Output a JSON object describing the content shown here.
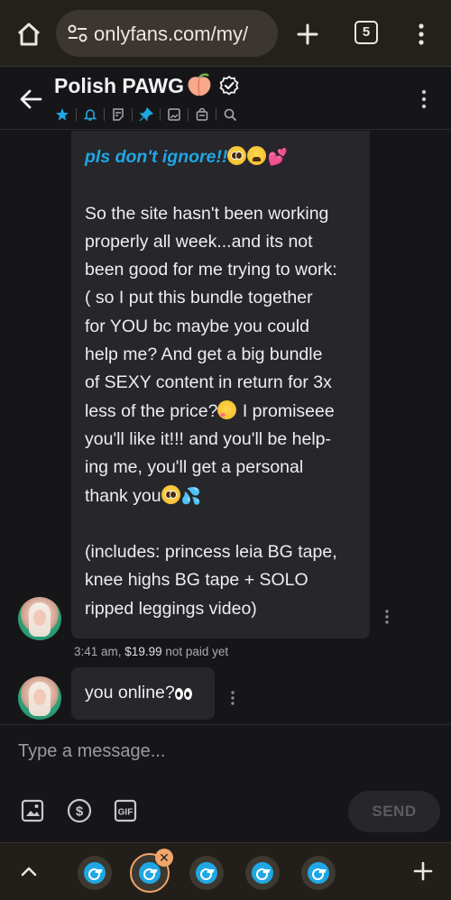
{
  "browser": {
    "url": "onlyfans.com/my/",
    "tab_count": "5"
  },
  "chat_header": {
    "name": "Polish PAWG",
    "icons": [
      "star-icon",
      "bell-icon",
      "notes-icon",
      "pin-icon",
      "image-icon",
      "bag-icon",
      "search-icon"
    ]
  },
  "messages": {
    "ppv_message": {
      "line1": "pls don't ignore!!",
      "lines": [
        "So the site hasn't been working",
        "properly all week...and its not",
        "been good for me trying to work:",
        "( so I put this bundle together",
        "for YOU bc maybe you could",
        "help me? And get a big bundle",
        "of SEXY content in return for 3x",
        "less of the price?",
        " I promiseee",
        "you'll like it!!! and you'll be help-",
        "ing me, you'll get a personal",
        "thank you"
      ],
      "includes": [
        "(includes: princess leia BG tape,",
        "knee highs BG tape + SOLO",
        "ripped leggings video)"
      ],
      "time": "3:41 am,",
      "price": "$19.99",
      "status": "not paid yet"
    },
    "second_message": {
      "text": "you online?"
    }
  },
  "composer": {
    "placeholder": "Type a message...",
    "send_label": "SEND",
    "gif_label": "GIF"
  },
  "tabbar": {
    "close_label": "✕"
  }
}
